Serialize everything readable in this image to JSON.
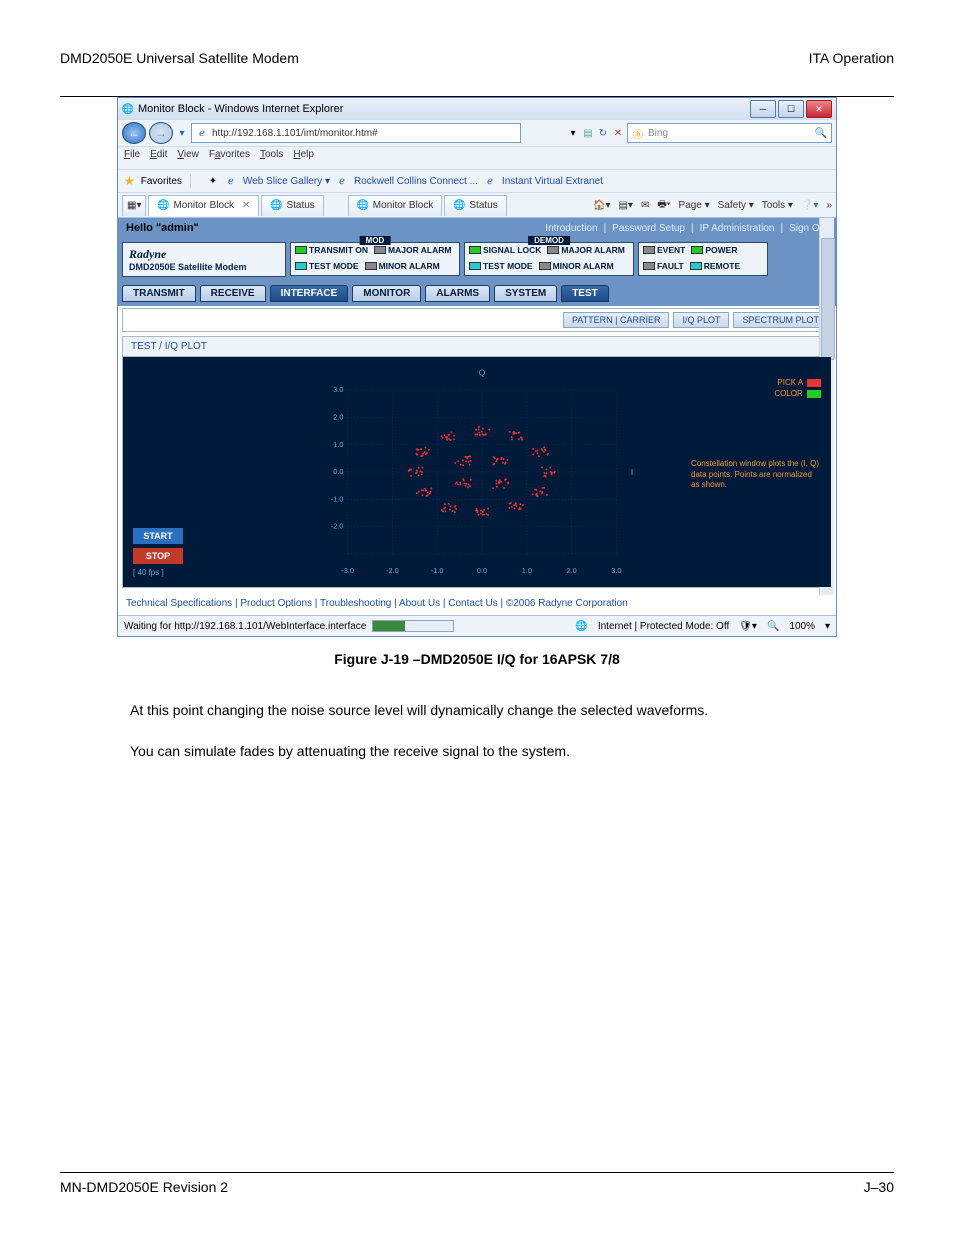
{
  "doc": {
    "header_left": "DMD2050E Universal Satellite Modem",
    "header_right": "ITA Operation",
    "caption": "Figure J-19 –DMD2050E I/Q for 16APSK 7/8",
    "para1": "At this point changing the noise source level will dynamically change the selected waveforms.",
    "para2": "You can simulate fades by attenuating the receive signal to the system.",
    "footer_left": "MN-DMD2050E   Revision 2",
    "footer_right": "J–30"
  },
  "browser": {
    "title": "Monitor Block - Windows Internet Explorer",
    "url": "http://192.168.1.101/imt/monitor.htm#",
    "search_placeholder": "Bing",
    "menus": {
      "file": "File",
      "edit": "Edit",
      "view": "View",
      "favorites": "Favorites",
      "tools": "Tools",
      "help": "Help"
    },
    "favbar": {
      "label": "Favorites",
      "items": [
        "Web Slice Gallery ▾",
        "Rockwell Collins Connect ...",
        "Instant Virtual Extranet"
      ]
    },
    "tabs": [
      {
        "label": "Monitor Block",
        "active": true,
        "closable": true
      },
      {
        "label": "Status",
        "active": false
      },
      {
        "label": "Monitor Block",
        "active": false
      },
      {
        "label": "Status",
        "active": false
      }
    ],
    "cmd_bar": {
      "page": "Page ▾",
      "safety": "Safety ▾",
      "tools": "Tools ▾"
    },
    "status_bar": {
      "left": "Waiting for http://192.168.1.101/WebInterface.interface",
      "zone": "Internet | Protected Mode: Off",
      "zoom": "100%"
    }
  },
  "app": {
    "hello": "Hello \"admin\"",
    "top_links": [
      "Introduction",
      "Password Setup",
      "IP Administration",
      "Sign Out"
    ],
    "brand": "Radyne",
    "brand_sub": "DMD2050E Satellite Modem",
    "mod": {
      "title": "MOD",
      "leds": [
        {
          "label": "TRANSMIT ON",
          "color": "green"
        },
        {
          "label": "MAJOR ALARM",
          "color": "gray"
        },
        {
          "label": "TEST MODE",
          "color": "cyan"
        },
        {
          "label": "MINOR ALARM",
          "color": "gray"
        }
      ]
    },
    "demod": {
      "title": "DEMOD",
      "leds": [
        {
          "label": "SIGNAL LOCK",
          "color": "green"
        },
        {
          "label": "MAJOR ALARM",
          "color": "gray"
        },
        {
          "label": "TEST MODE",
          "color": "cyan"
        },
        {
          "label": "MINOR ALARM",
          "color": "gray"
        }
      ]
    },
    "side": {
      "leds": [
        {
          "label": "EVENT",
          "color": "gray"
        },
        {
          "label": "POWER",
          "color": "green"
        },
        {
          "label": "FAULT",
          "color": "gray"
        },
        {
          "label": "REMOTE",
          "color": "cyan"
        }
      ]
    },
    "nav_tabs": [
      "TRANSMIT",
      "RECEIVE",
      "INTERFACE",
      "MONITOR",
      "ALARMS",
      "SYSTEM",
      "TEST"
    ],
    "sub_tabs": [
      "PATTERN | CARRIER",
      "I/Q PLOT",
      "SPECTRUM PLOT"
    ],
    "panel_title": "TEST / I/Q PLOT",
    "buttons": {
      "start": "START",
      "stop": "STOP",
      "fps": "[ 40 fps ]"
    },
    "right_panel": {
      "pick": "PICK A",
      "color": "COLOR",
      "info": "Constellation window plots the (I, Q) data points. Points are normalized as shown."
    },
    "footer": "Technical Specifications | Product Options | Troubleshooting | About Us | Contact Us | ©2006 Radyne Corporation"
  },
  "chart_data": {
    "type": "scatter",
    "title": "Q",
    "xlabel": "I",
    "xlim": [
      -3.0,
      3.0
    ],
    "ylim": [
      -3.0,
      3.0
    ],
    "x_ticks": [
      -3.0,
      -2.0,
      -1.0,
      0.0,
      1.0,
      2.0,
      3.0
    ],
    "y_ticks": [
      -2.0,
      -1.0,
      0.0,
      1.0,
      2.0,
      3.0
    ],
    "note": "16APSK constellation: inner ring radius ≈ 0.6 with 4 clusters; outer ring radius ≈ 1.5 with 12 clusters; noisy scatter around each center",
    "series": [
      {
        "name": "centers",
        "points": [
          [
            0.42,
            0.42
          ],
          [
            -0.42,
            0.42
          ],
          [
            -0.42,
            -0.42
          ],
          [
            0.42,
            -0.42
          ],
          [
            1.5,
            0.0
          ],
          [
            1.3,
            0.75
          ],
          [
            0.75,
            1.3
          ],
          [
            0.0,
            1.5
          ],
          [
            -0.75,
            1.3
          ],
          [
            -1.3,
            0.75
          ],
          [
            -1.5,
            0.0
          ],
          [
            -1.3,
            -0.75
          ],
          [
            -0.75,
            -1.3
          ],
          [
            0.0,
            -1.5
          ],
          [
            0.75,
            -1.3
          ],
          [
            1.3,
            -0.75
          ]
        ]
      }
    ]
  }
}
